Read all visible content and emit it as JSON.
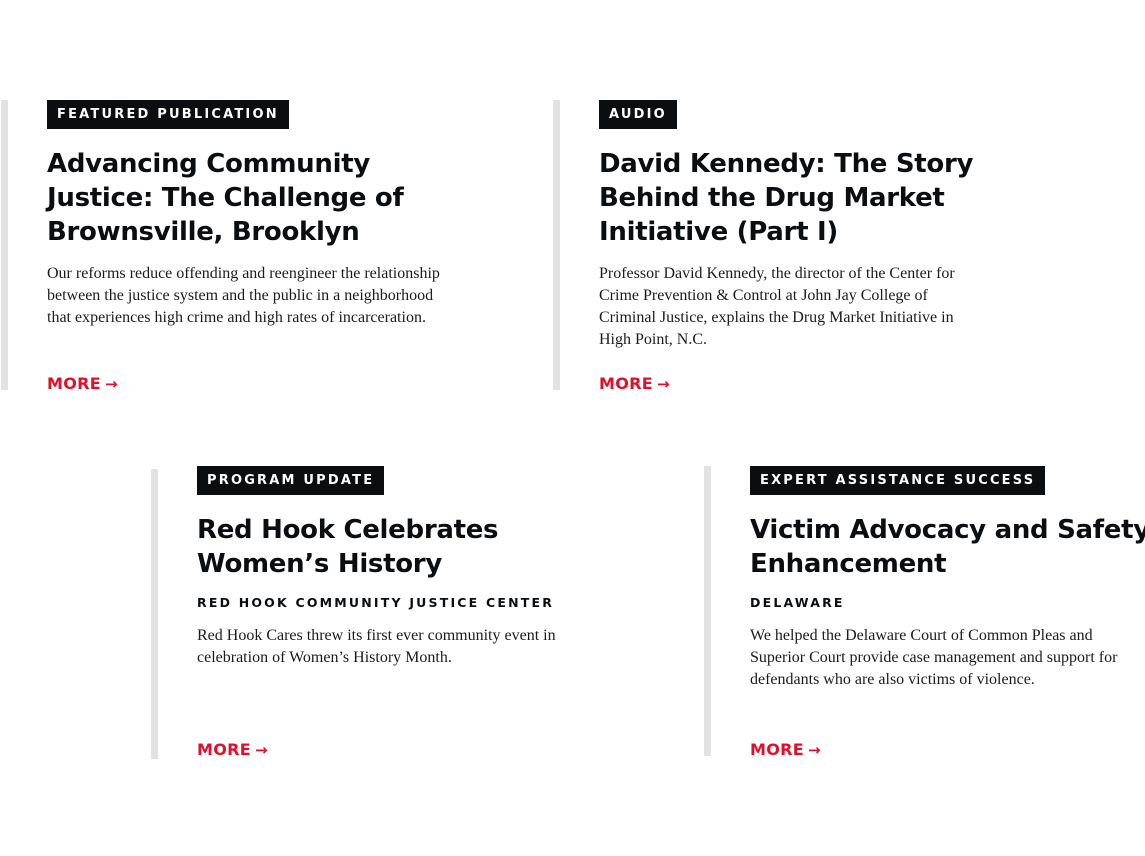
{
  "colors": {
    "tag_bg": "#0b0e11",
    "accent": "#e0102c",
    "rule": "#e2e2e2"
  },
  "cards": [
    {
      "tag": "FEATURED PUBLICATION",
      "title": "Advancing Community Justice: The Challenge of Brownsville, Brooklyn",
      "subtitle": "",
      "description": "Our reforms reduce offending and reengineer the relationship between the justice system and the public in a neighborhood that experiences high crime and high rates of incarceration.",
      "link_label": "MORE",
      "link_icon": "arrow-right-icon",
      "arrow": "→"
    },
    {
      "tag": "AUDIO",
      "title": "David Kennedy: The Story Behind the Drug Market Initiative (Part I)",
      "subtitle": "",
      "description": "Professor David Kennedy, the director of the Center for Crime Prevention & Control at John Jay College of Criminal Justice, explains the Drug Market Initiative in High Point, N.C.",
      "link_label": "MORE",
      "link_icon": "arrow-right-icon",
      "arrow": "→"
    },
    {
      "tag": "PROGRAM UPDATE",
      "title": "Red Hook Celebrates Women’s History",
      "subtitle": "RED HOOK COMMUNITY JUSTICE CENTER",
      "description": "Red Hook Cares threw its first ever community event in celebration of Women’s History Month.",
      "link_label": "MORE",
      "link_icon": "arrow-right-icon",
      "arrow": "→"
    },
    {
      "tag": "EXPERT ASSISTANCE SUCCESS",
      "title": "Victim Advocacy and Safety Enhancement",
      "subtitle": "DELAWARE",
      "description": "We helped the Delaware Court of Common Pleas and Superior Court provide case management and support for defendants who are also victims of violence.",
      "link_label": "MORE",
      "link_icon": "arrow-right-icon",
      "arrow": "→"
    }
  ]
}
